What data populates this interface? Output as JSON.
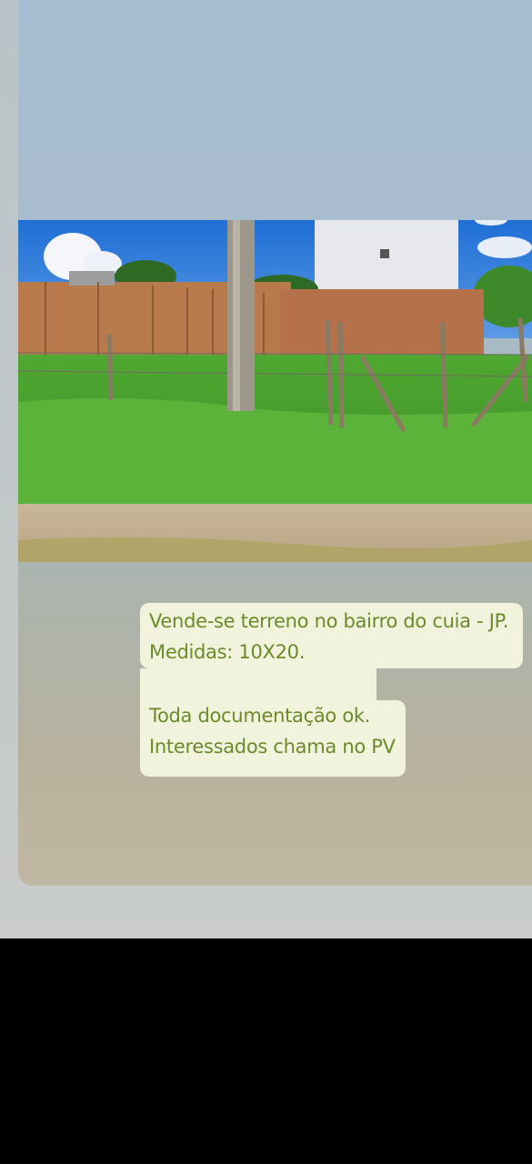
{
  "post": {
    "lines": [
      "Vende-se terreno no bairro do cuia - JP.",
      "Medidas: 10X20.",
      "Toda documentação ok.",
      "Interessados chama no PV"
    ],
    "text_color": "#6c8a2a",
    "box_color": "#f1f3dd"
  },
  "photo": {
    "subject": "vacant-lot-with-brick-wall-photo"
  }
}
